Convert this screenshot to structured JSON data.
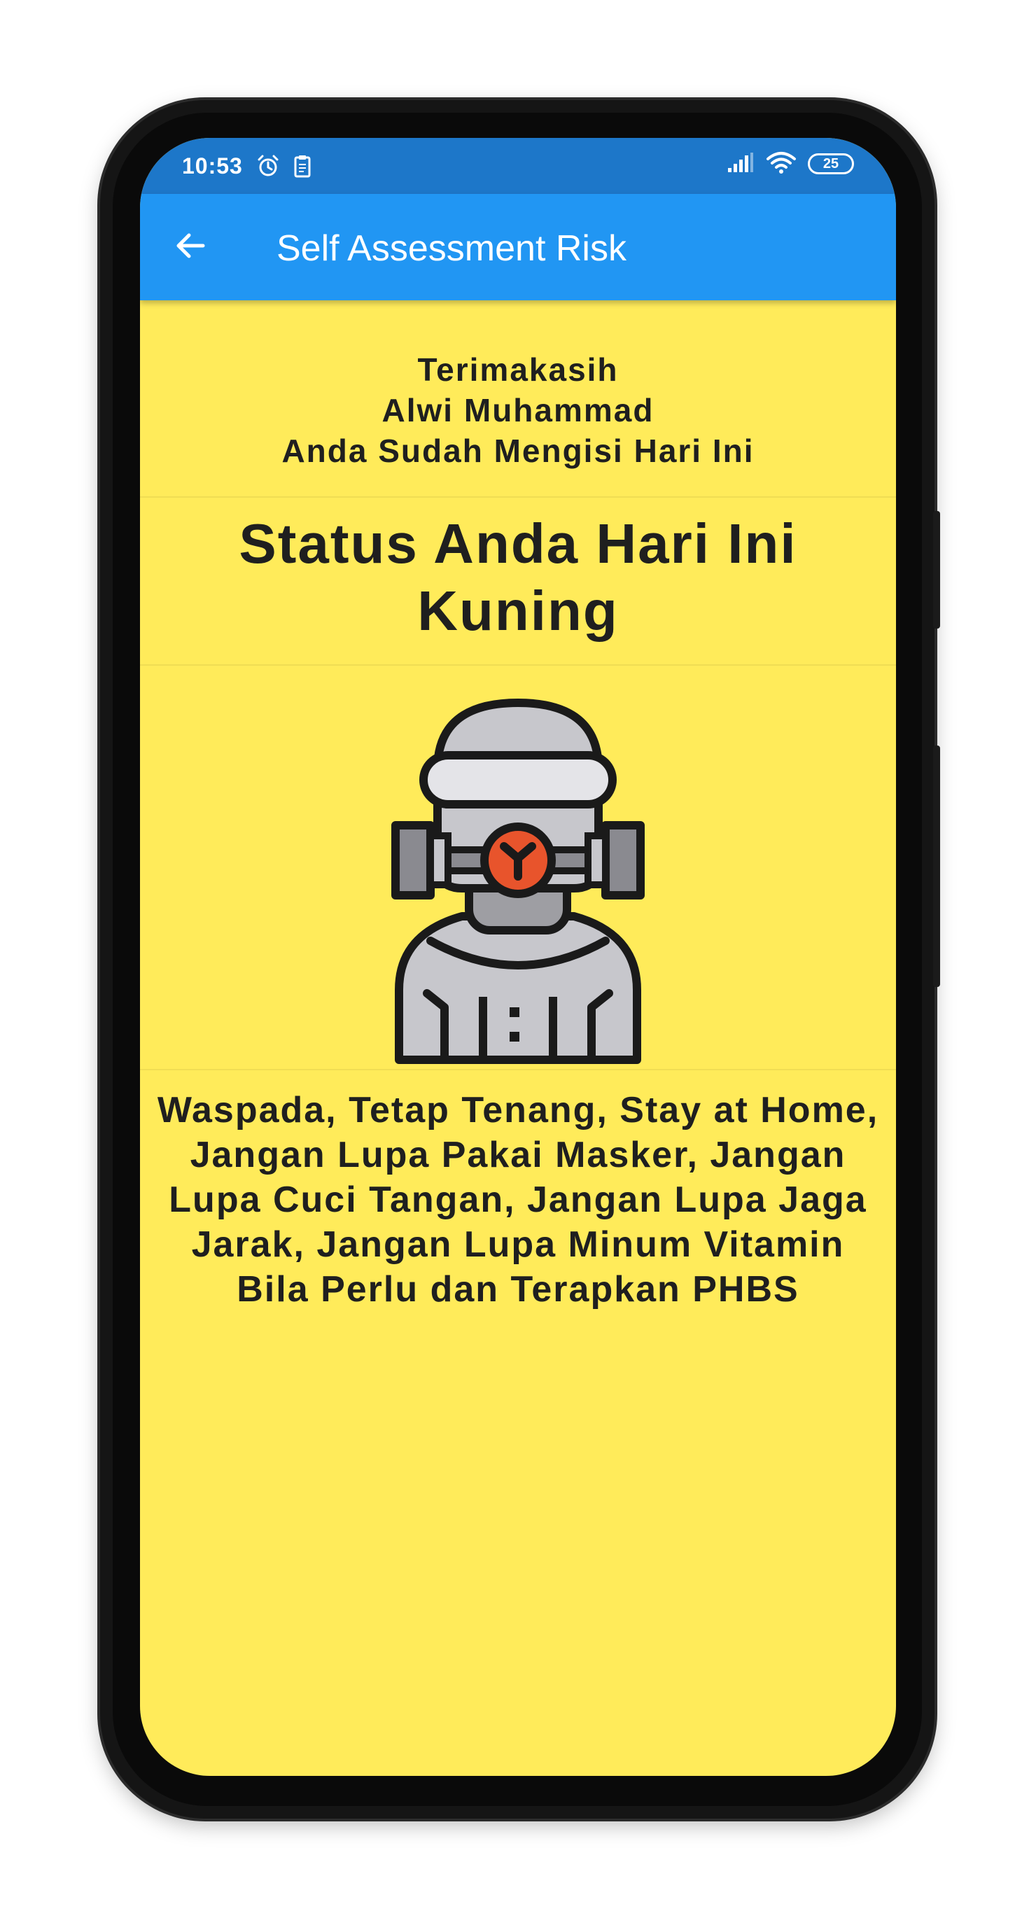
{
  "status_bar": {
    "time": "10:53",
    "battery": "25",
    "left_icons": [
      "alarm-icon",
      "clipboard-icon"
    ],
    "right_icons": [
      "signal-icon",
      "wifi-icon",
      "battery-icon"
    ]
  },
  "app_bar": {
    "back_icon": "arrow-left-icon",
    "title": "Self Assessment Risk",
    "color": "#2196F3"
  },
  "result": {
    "thanks_lines": [
      "Terimakasih",
      "Alwi Muhammad",
      "Anda Sudah Mengisi Hari Ini"
    ],
    "status_lines": [
      "Status Anda Hari Ini",
      "Kuning"
    ],
    "illustration_icon": "hazmat-suit-gas-mask-icon",
    "advice_lines": [
      "Waspada, Tetap Tenang, Stay at Home,",
      "Jangan Lupa Pakai Masker, Jangan",
      "Lupa Cuci Tangan, Jangan Lupa Jaga",
      "Jarak, Jangan Lupa Minum Vitamin",
      "Bila Perlu dan Terapkan PHBS"
    ],
    "background_color": "#FFEB5A"
  }
}
